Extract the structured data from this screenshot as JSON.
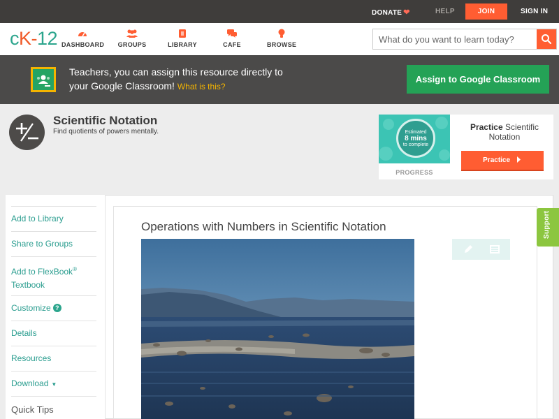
{
  "topbar": {
    "donate": "DONATE",
    "help": "HELP",
    "join": "JOIN",
    "signin": "SIGN IN"
  },
  "nav": {
    "logo": {
      "c": "c",
      "k": "K",
      "dash": "-",
      "n": "12"
    },
    "items": [
      {
        "label": "DASHBOARD",
        "icon": "dashboard-icon"
      },
      {
        "label": "GROUPS",
        "icon": "groups-icon"
      },
      {
        "label": "LIBRARY",
        "icon": "library-icon"
      },
      {
        "label": "CAFE",
        "icon": "cafe-icon"
      },
      {
        "label": "BROWSE",
        "icon": "browse-icon"
      }
    ],
    "search_placeholder": "What do you want to learn today?"
  },
  "banner": {
    "line1": "Teachers, you can assign this resource directly to",
    "line2": "your Google Classroom!",
    "what": "What is this?",
    "assign": "Assign to Google Classroom"
  },
  "concept": {
    "title": "Scientific Notation",
    "subtitle": "Find quotients of powers mentally."
  },
  "practice": {
    "estimated": "Estimated",
    "mins": "8 mins",
    "to_complete": "to complete",
    "progress_label": "PROGRESS",
    "title_bold": "Practice",
    "title_rest": "Scientific Notation",
    "button": "Practice"
  },
  "sidebar": {
    "add_library": "Add to Library",
    "share_groups": "Share to Groups",
    "add_flexbook_1": "Add to FlexBook",
    "add_flexbook_reg": "®",
    "add_flexbook_2": "Textbook",
    "customize": "Customize",
    "details": "Details",
    "resources": "Resources",
    "download": "Download",
    "quick_tips": "Quick Tips"
  },
  "lesson": {
    "title": "Operations with Numbers in Scientific Notation"
  },
  "support": "Support",
  "colors": {
    "accent": "#ff5d32",
    "teal": "#2ca58d",
    "google_green": "#24a256",
    "support_green": "#8cc63f"
  }
}
